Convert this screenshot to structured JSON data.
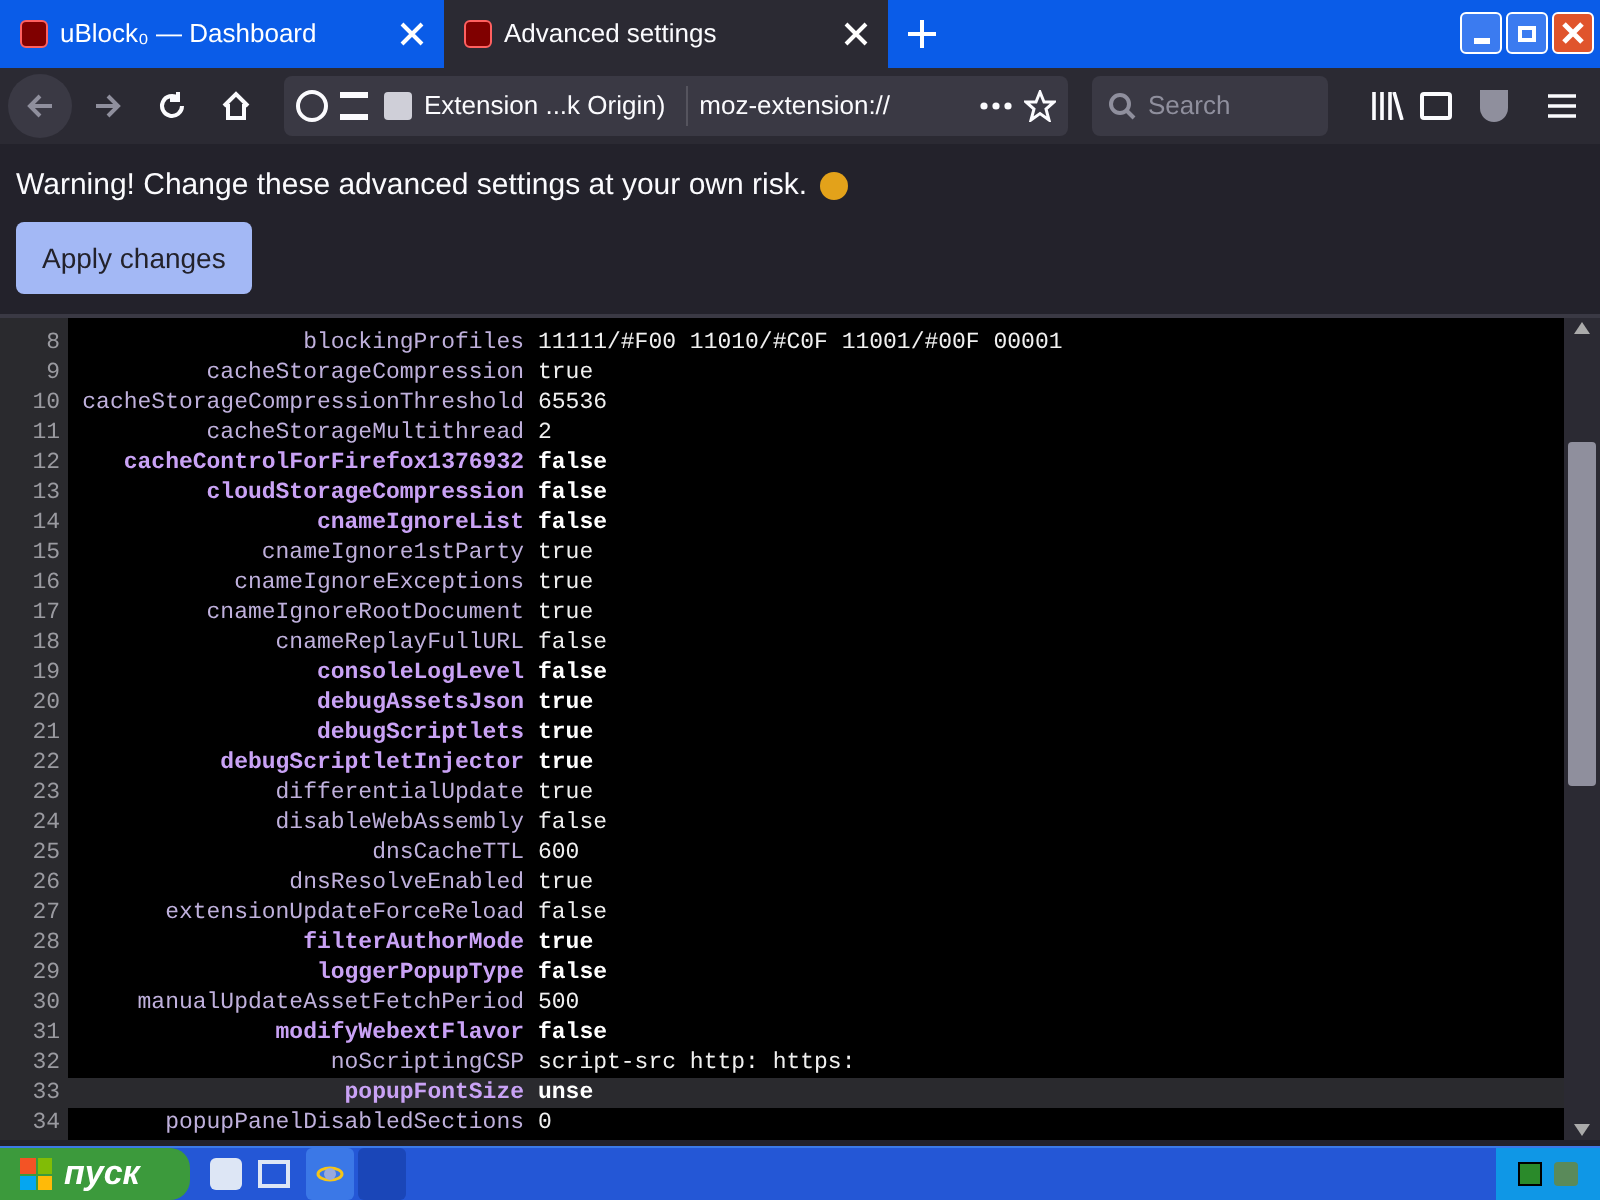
{
  "tabs": [
    {
      "label": "uBlock₀ — Dashboard",
      "selected": false
    },
    {
      "label": "Advanced settings",
      "selected": true
    }
  ],
  "address_bar": {
    "site_label": "Extension ...k Origin)",
    "url": "moz-extension://"
  },
  "search": {
    "placeholder": "Search"
  },
  "warning": "Warning! Change these advanced settings at your own risk.",
  "apply_button": "Apply changes",
  "editor_lines": [
    {
      "number": "8",
      "key": "blockingProfiles",
      "value": "11111/#F00 11010/#C0F 11001/#00F 00001",
      "modified": false,
      "active": false
    },
    {
      "number": "9",
      "key": "cacheStorageCompression",
      "value": "true",
      "modified": false,
      "active": false
    },
    {
      "number": "10",
      "key": "cacheStorageCompressionThreshold",
      "value": "65536",
      "modified": false,
      "active": false
    },
    {
      "number": "11",
      "key": "cacheStorageMultithread",
      "value": "2",
      "modified": false,
      "active": false
    },
    {
      "number": "12",
      "key": "cacheControlForFirefox1376932",
      "value": "false",
      "modified": true,
      "active": false
    },
    {
      "number": "13",
      "key": "cloudStorageCompression",
      "value": "false",
      "modified": true,
      "active": false
    },
    {
      "number": "14",
      "key": "cnameIgnoreList",
      "value": "false",
      "modified": true,
      "active": false
    },
    {
      "number": "15",
      "key": "cnameIgnore1stParty",
      "value": "true",
      "modified": false,
      "active": false
    },
    {
      "number": "16",
      "key": "cnameIgnoreExceptions",
      "value": "true",
      "modified": false,
      "active": false
    },
    {
      "number": "17",
      "key": "cnameIgnoreRootDocument",
      "value": "true",
      "modified": false,
      "active": false
    },
    {
      "number": "18",
      "key": "cnameReplayFullURL",
      "value": "false",
      "modified": false,
      "active": false
    },
    {
      "number": "19",
      "key": "consoleLogLevel",
      "value": "false",
      "modified": true,
      "active": false
    },
    {
      "number": "20",
      "key": "debugAssetsJson",
      "value": "true",
      "modified": true,
      "active": false
    },
    {
      "number": "21",
      "key": "debugScriptlets",
      "value": "true",
      "modified": true,
      "active": false
    },
    {
      "number": "22",
      "key": "debugScriptletInjector",
      "value": "true",
      "modified": true,
      "active": false
    },
    {
      "number": "23",
      "key": "differentialUpdate",
      "value": "true",
      "modified": false,
      "active": false
    },
    {
      "number": "24",
      "key": "disableWebAssembly",
      "value": "false",
      "modified": false,
      "active": false
    },
    {
      "number": "25",
      "key": "dnsCacheTTL",
      "value": "600",
      "modified": false,
      "active": false
    },
    {
      "number": "26",
      "key": "dnsResolveEnabled",
      "value": "true",
      "modified": false,
      "active": false
    },
    {
      "number": "27",
      "key": "extensionUpdateForceReload",
      "value": "false",
      "modified": false,
      "active": false
    },
    {
      "number": "28",
      "key": "filterAuthorMode",
      "value": "true",
      "modified": true,
      "active": false
    },
    {
      "number": "29",
      "key": "loggerPopupType",
      "value": "false",
      "modified": true,
      "active": false
    },
    {
      "number": "30",
      "key": "manualUpdateAssetFetchPeriod",
      "value": "500",
      "modified": false,
      "active": false
    },
    {
      "number": "31",
      "key": "modifyWebextFlavor",
      "value": "false",
      "modified": true,
      "active": false
    },
    {
      "number": "32",
      "key": "noScriptingCSP",
      "value": "script-src http: https:",
      "modified": false,
      "active": false
    },
    {
      "number": "33",
      "key": "popupFontSize",
      "value": "unse",
      "modified": true,
      "active": true
    },
    {
      "number": "34",
      "key": "popupPanelDisabledSections",
      "value": "0",
      "modified": false,
      "active": false
    }
  ],
  "taskbar": {
    "start_label": "пуск"
  }
}
